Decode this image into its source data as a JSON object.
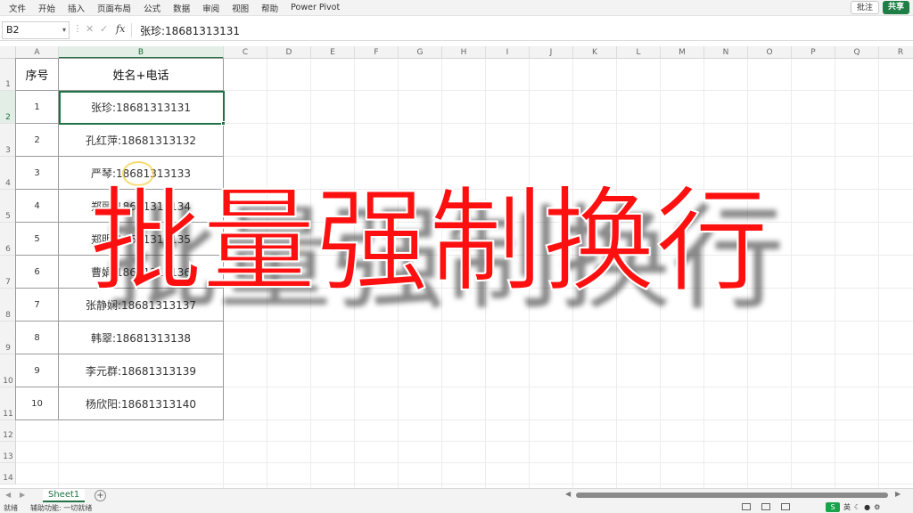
{
  "menu": {
    "items": [
      "文件",
      "开始",
      "插入",
      "页面布局",
      "公式",
      "数据",
      "审阅",
      "视图",
      "帮助",
      "Power Pivot"
    ],
    "comment_label": "批注",
    "share_label": "共享"
  },
  "formula_bar": {
    "cell_ref": "B2",
    "fx_label": "fx",
    "value": "张珍:18681313131"
  },
  "grid": {
    "columns": [
      "A",
      "B",
      "C",
      "D",
      "E",
      "F",
      "G",
      "H",
      "I",
      "J",
      "K",
      "L",
      "M",
      "N",
      "O",
      "P",
      "Q",
      "R"
    ],
    "rows": [
      "1",
      "2",
      "3",
      "4",
      "5",
      "6",
      "7",
      "8",
      "9",
      "10",
      "11",
      "12",
      "13",
      "14"
    ],
    "selected_column": "B",
    "selected_row": "2"
  },
  "table": {
    "headers": [
      "序号",
      "姓名+电话"
    ],
    "rows": [
      {
        "num": "1",
        "value": "张珍:18681313131"
      },
      {
        "num": "2",
        "value": "孔红萍:18681313132"
      },
      {
        "num": "3",
        "value": "严琴:18681313133"
      },
      {
        "num": "4",
        "value": "郑丽:18681313134"
      },
      {
        "num": "5",
        "value": "郑明:18681313135"
      },
      {
        "num": "6",
        "value": "曹娟:18681313136"
      },
      {
        "num": "7",
        "value": "张静娴:18681313137"
      },
      {
        "num": "8",
        "value": "韩翠:18681313138"
      },
      {
        "num": "9",
        "value": "李元群:18681313139"
      },
      {
        "num": "10",
        "value": "杨欣阳:18681313140"
      }
    ]
  },
  "overlay": {
    "text": "批量强制换行",
    "color": "#ff1010"
  },
  "sheets": {
    "tabs": [
      "Sheet1"
    ],
    "active": "Sheet1",
    "add_label": "+"
  },
  "status": {
    "ready": "就绪",
    "accessibility": "辅助功能: 一切就绪",
    "ime_label": "S",
    "ime_lang": "英"
  },
  "colors": {
    "accent": "#217346",
    "overlay_red": "#ff1010"
  }
}
